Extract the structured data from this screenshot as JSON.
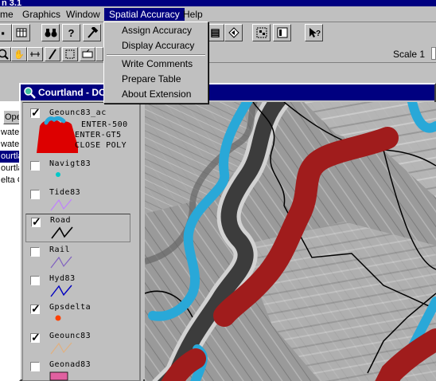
{
  "app": {
    "title_fragment": "n 3.1"
  },
  "menubar": {
    "items": [
      {
        "label": "me"
      },
      {
        "label": "Graphics"
      },
      {
        "label": "Window"
      },
      {
        "label": "Spatial Accuracy",
        "active": true
      },
      {
        "label": "Help"
      }
    ]
  },
  "dropdown": {
    "items": [
      {
        "label": "Assign Accuracy"
      },
      {
        "label": "Display Accuracy"
      },
      {
        "label": "Write Comments"
      },
      {
        "label": "Prepare Table"
      },
      {
        "label": "About Extension"
      }
    ]
  },
  "toolbar": {
    "scale_label": "Scale 1",
    "icons": [
      "save-icon",
      "table-icon",
      "binoculars-icon",
      "query-icon",
      "hammer-icon",
      "zoom-extent-icon",
      "zoom-active-icon",
      "select-features-icon",
      "layout-icon",
      "help-cursor-icon"
    ],
    "tools": [
      "zoom-in-icon",
      "pan-hand-icon",
      "measure-icon",
      "pencil-icon",
      "select-box-icon",
      "label-icon"
    ]
  },
  "background_window": {
    "tab_label": "Ope",
    "lines": [
      {
        "text": "wate",
        "selected": false
      },
      {
        "text": "wate",
        "selected": false
      },
      {
        "text": "ourtla",
        "selected": true
      },
      {
        "text": "ourtla",
        "selected": false
      },
      {
        "text": "elta G",
        "selected": false
      }
    ]
  },
  "view": {
    "title": "Courtland - DC",
    "themes": [
      {
        "name": "Geounc83_ac",
        "checked": true,
        "legend_lines": [
          "ENTER-500",
          "ENTER-GT5",
          "CLOSE POLY"
        ],
        "symbol": "polygon",
        "color": "#dd0000"
      },
      {
        "name": "Navigt83",
        "checked": false,
        "symbol": "point",
        "color": "#00c8c8"
      },
      {
        "name": "Tide83",
        "checked": false,
        "symbol": "line",
        "color": "#c080ff"
      },
      {
        "name": "Road",
        "checked": true,
        "symbol": "line",
        "color": "#000000",
        "highlighted": true
      },
      {
        "name": "Rail",
        "checked": false,
        "symbol": "line",
        "color": "#8060c0"
      },
      {
        "name": "Hyd83",
        "checked": false,
        "symbol": "line",
        "color": "#0000c0"
      },
      {
        "name": "Gpsdelta",
        "checked": true,
        "symbol": "point",
        "color": "#ff4000"
      },
      {
        "name": "Geounc83",
        "checked": true,
        "symbol": "line",
        "color": "#e0b080"
      },
      {
        "name": "Geonad83",
        "checked": false,
        "symbol": "polygon",
        "color": "#e060a0"
      }
    ]
  },
  "map": {
    "colors": {
      "uncertainty_band": "#a01c1c",
      "cyan_band": "#29a8d8",
      "road": "#000000",
      "river": "#3c3c3c"
    }
  }
}
